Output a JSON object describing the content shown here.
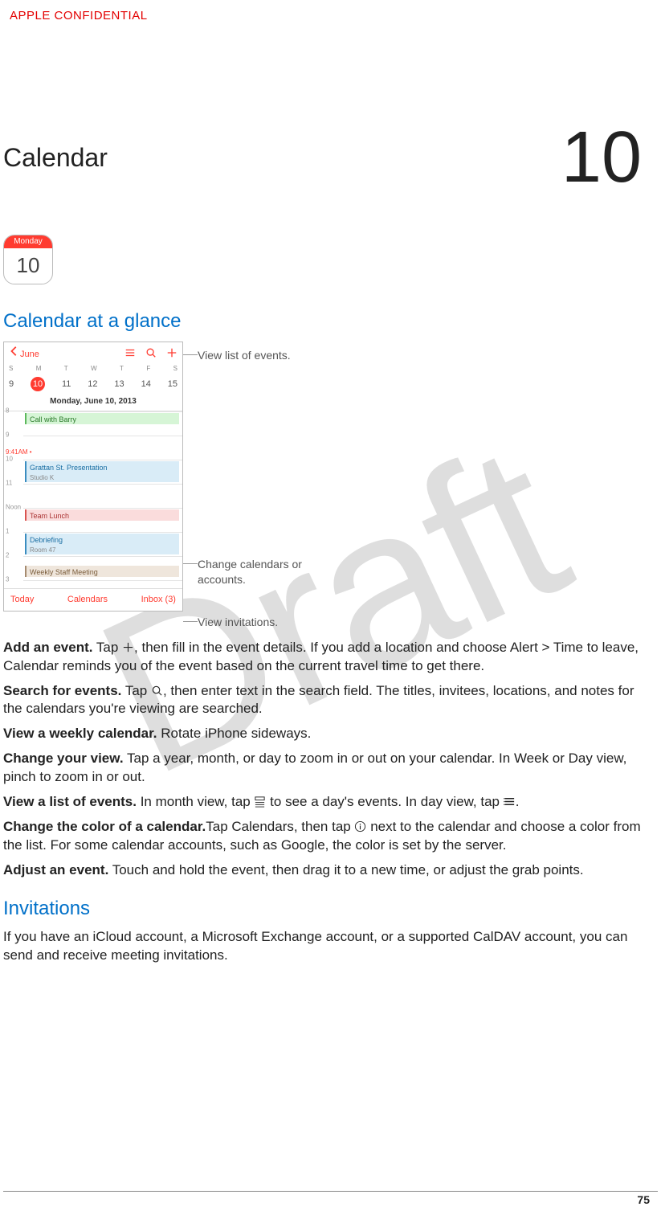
{
  "watermark": "Draft",
  "header": {
    "confidential": "APPLE CONFIDENTIAL"
  },
  "chapter": {
    "title": "Calendar",
    "number": "10"
  },
  "app_icon": {
    "month": "Monday",
    "day": "10"
  },
  "section1": {
    "heading": "Calendar at a glance",
    "callouts": {
      "list": "View list of events.",
      "calendars": "Change calendars or accounts.",
      "invitations": "View invitations."
    }
  },
  "phone": {
    "back_label": "June",
    "weekdays": [
      "S",
      "M",
      "T",
      "W",
      "T",
      "F",
      "S"
    ],
    "weeknums": [
      "9",
      "10",
      "11",
      "12",
      "13",
      "14",
      "15"
    ],
    "date_label": "Monday, June 10, 2013",
    "hours": {
      "eight": "8",
      "nine": "9",
      "ten": "10",
      "eleven": "11",
      "noon": "Noon",
      "one": "1",
      "two": "2",
      "three": "3"
    },
    "now_label": "9:41AM",
    "events": {
      "e1": {
        "title": "Call with Barry"
      },
      "e2": {
        "title": "Grattan St. Presentation",
        "sub": "Studio K"
      },
      "e3": {
        "title": "Team Lunch"
      },
      "e4": {
        "title": "Debriefing",
        "sub": "Room 47"
      },
      "e5": {
        "title": "Weekly Staff Meeting"
      }
    },
    "bottom": {
      "today": "Today",
      "calendars": "Calendars",
      "inbox": "Inbox (3)"
    }
  },
  "paragraphs": {
    "p1_bold": "Add an event.",
    "p1_a": " Tap ",
    "p1_b": ", then fill in the event details. If you add a location and choose Alert > Time to leave, Calendar reminds you of the event based on the current travel time to get there.",
    "p2_bold": "Search for events.",
    "p2_a": " Tap ",
    "p2_b": ", then enter text in the search field. The titles, invitees, locations, and notes for the calendars you're viewing are searched.",
    "p3_bold": "View a weekly calendar.",
    "p3_a": " Rotate iPhone sideways.",
    "p4_bold": "Change your view.",
    "p4_a": " Tap a year, month, or day to zoom in or out on your calendar. In Week or Day view, pinch to zoom in or out.",
    "p5_bold": "View a list of events.",
    "p5_a": " In month view, tap ",
    "p5_b": " to see a day's events. In day view, tap ",
    "p5_c": ".",
    "p6_bold": "Change the color of a calendar.",
    "p6_a": "Tap Calendars, then tap ",
    "p6_b": " next to the calendar and choose a color from the list. For some calendar accounts, such as Google, the color is set by the server.",
    "p7_bold": "Adjust an event.",
    "p7_a": " Touch and hold the event, then drag it to a new time, or adjust the grab points."
  },
  "section2": {
    "heading": "Invitations",
    "para": "If you have an iCloud account, a Microsoft Exchange account, or a supported CalDAV account, you can send and receive meeting invitations."
  },
  "page_number": "75"
}
